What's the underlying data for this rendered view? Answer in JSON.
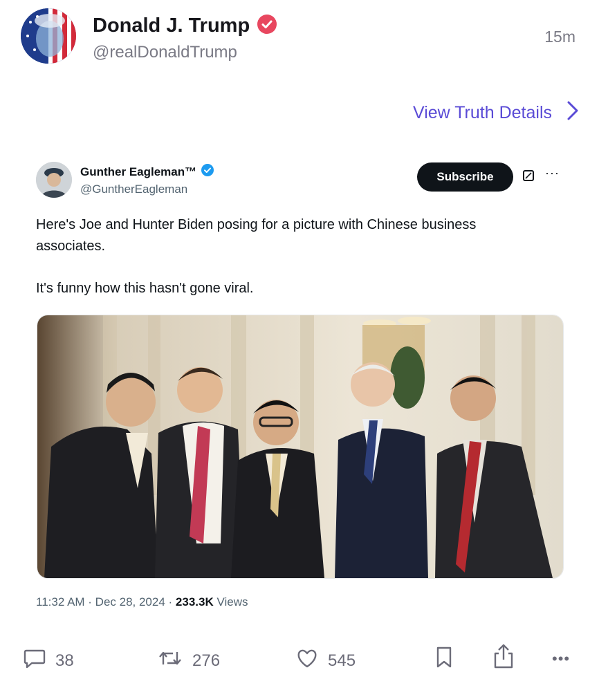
{
  "truth": {
    "author_name": "Donald J. Trump",
    "author_handle": "@realDonaldTrump",
    "time_ago": "15m",
    "view_details_label": "View Truth Details",
    "verified_color": "#e8475f"
  },
  "embedded_post": {
    "author_name": "Gunther Eagleman™",
    "author_handle": "@GuntherEagleman",
    "subscribe_label": "Subscribe",
    "text_line1": "Here's Joe and Hunter Biden posing for a picture with Chinese business\nassociates.",
    "text_line2": "It's funny how this hasn't gone viral.",
    "photo_icon": "group-photo",
    "timestamp": "11:32 AM · Dec 28, 2024 · ",
    "views_count": "233.3K",
    "views_label": "Views",
    "verified_color": "#1d9bf0"
  },
  "actions": {
    "replies": "38",
    "retruths": "276",
    "likes": "545"
  },
  "colors": {
    "accent": "#5a4bd6",
    "text_secondary": "#7a7a85"
  }
}
